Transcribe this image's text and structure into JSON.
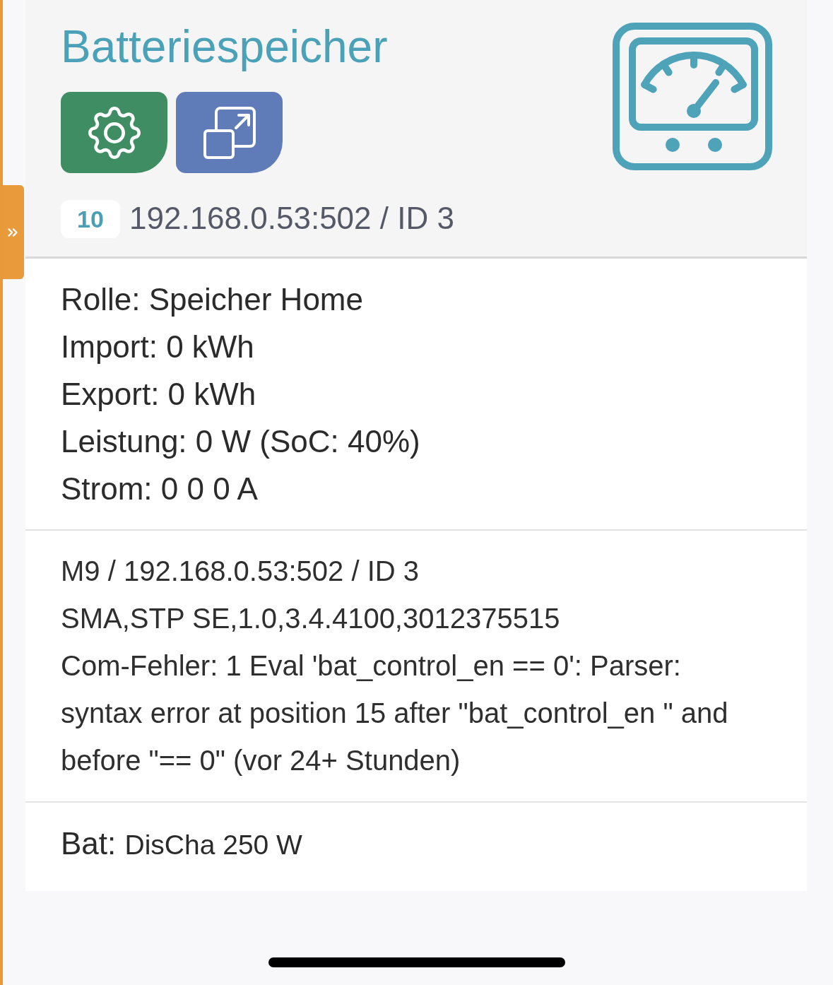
{
  "title": "Batteriespeicher",
  "badge": "10",
  "address": "192.168.0.53:502 / ID 3",
  "details": [
    "Rolle: Speicher Home",
    "Import: 0 kWh",
    "Export: 0 kWh",
    "Leistung: 0 W (SoC: 40%)",
    "Strom: 0 0 0 A"
  ],
  "device_info": [
    "M9 / 192.168.0.53:502 / ID 3",
    "SMA,STP SE,1.0,3.4.4100,3012375515",
    "Com-Fehler: 1 Eval 'bat_control_en == 0': Parser: syntax error at position 15 after \"bat_control_en \" and before \"== 0\" (vor 24+ Stunden)"
  ],
  "battery_status": {
    "label": "Bat:",
    "value": "DisCha 250 W"
  }
}
